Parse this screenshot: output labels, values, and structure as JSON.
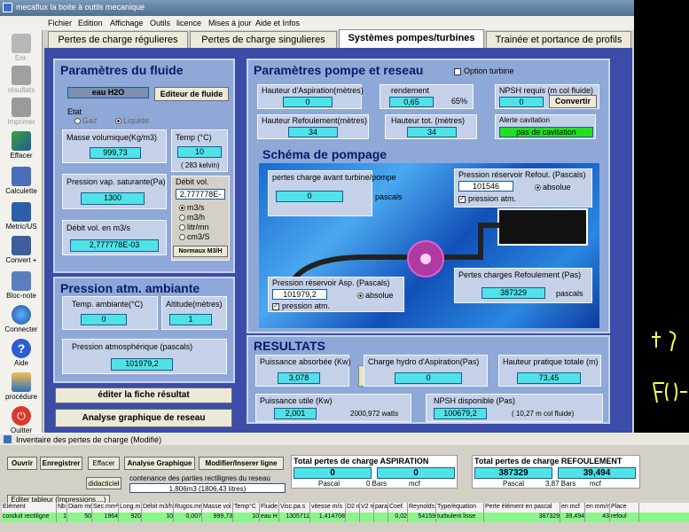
{
  "window": {
    "title": "mecaflux  la boite à outils mecanique"
  },
  "menu": [
    "Fichier",
    "Edition",
    "Affichage",
    "Outils",
    "licence",
    "Mises à jour",
    "Aide et Infos"
  ],
  "toolbar": [
    {
      "label": "Enr.",
      "icon": "save-icon",
      "enabled": false
    },
    {
      "label": "résultats",
      "icon": "results-icon",
      "enabled": false
    },
    {
      "label": "Imprimer",
      "icon": "printer-icon",
      "enabled": false
    },
    {
      "label": "Effacer",
      "icon": "eraser-icon",
      "enabled": true
    },
    {
      "label": "Calculette",
      "icon": "calculator-icon",
      "enabled": true
    },
    {
      "label": "Metric/US",
      "icon": "metric-us-icon",
      "enabled": true
    },
    {
      "label": "Convert +",
      "icon": "convert-icon",
      "enabled": true
    },
    {
      "label": "Bloc-note",
      "icon": "notepad-icon",
      "enabled": true
    },
    {
      "label": "Connecter",
      "icon": "globe-icon",
      "enabled": true
    },
    {
      "label": "Aide",
      "icon": "help-icon",
      "enabled": true
    },
    {
      "label": "procédure",
      "icon": "procedure-icon",
      "enabled": true
    },
    {
      "label": "Quitter",
      "icon": "quit-icon",
      "enabled": true
    }
  ],
  "tabs": [
    "Pertes de charge régulieres",
    "Pertes de charge singulieres",
    "Systèmes  pompes/turbines",
    "Trainée et portance de profils"
  ],
  "fluide": {
    "title": "Paramètres  du fluide",
    "fluid_name": "eau H2O",
    "editor_btn": "Editeur de fluide",
    "etat_label": "Etat",
    "gaz": "Gaz",
    "liquide": "Liquide",
    "masse_label": "Masse volumique(Kg/m3)",
    "masse_val": "999,73",
    "temp_label": "Temp (°C)",
    "temp_val": "10",
    "temp_kelvin": "( 283 kelvin)",
    "pvap_label": "Pression  vap. saturante(Pa)",
    "pvap_val": "1300",
    "debit_vol_label": "Débit vol.",
    "debit_vol_val": "2,777778E-03",
    "debit_units": [
      "m3/s",
      "m3/h",
      "litr/mn",
      "cm3/S"
    ],
    "normaux": "Normaux M3/H",
    "debit_m3s_label": "Débit vol. en m3/s",
    "debit_m3s_val": "2,777778E-03"
  },
  "atm": {
    "title": "Pression atm. ambiante",
    "temp_label": "Temp. ambiante(°C)",
    "temp_val": "0",
    "alt_label": "Altitude(mètres)",
    "alt_val": "1",
    "patm_label": "Pression atmosphérique  (pascals)",
    "patm_val": "101979,2"
  },
  "actions": {
    "fiche": "éditer la fiche résultat",
    "analyse": "Analyse graphique de reseau"
  },
  "pompe": {
    "title": "Paramètres  pompe et reseau",
    "option_turbine": "Option turbine",
    "h_asp_label": "Hauteur d'Aspiration(mètres)",
    "h_asp_val": "0",
    "rendement_label": "rendement",
    "rendement_val": "0,65",
    "rendement_pct": "65%",
    "npsh_label": "NPSH requis  (m col fluide)",
    "npsh_val": "0",
    "convertir": "Convertir",
    "h_ref_label": "Hauteur Refoulement(mètres)",
    "h_ref_val": "34",
    "h_tot_label": "Hauteur tot. (mètres)",
    "h_tot_val": "34",
    "alerte_label": "Alerte cavitation",
    "alerte_val": "pas de cavitation"
  },
  "schema": {
    "title": "Schéma de pompage",
    "pertes_avant_label": "pertes charge avant turbine/pompe",
    "pertes_avant_val": "0",
    "pascals": "pascals",
    "p_ref_label": "Pression réservoir Refoul. (Pascals)",
    "p_ref_val": "101546",
    "absolue": "absolue",
    "pression_atm": "pression atm.",
    "p_asp_label": "Pression réservoir Asp. (Pascals)",
    "p_asp_val": "101979,2",
    "pertes_ref_label": "Pertes charges Refoulement (Pas)",
    "pertes_ref_val": "387329"
  },
  "resultats": {
    "title": "RESULTATS",
    "p_abs_label": "Puissance absorbée (Kw)",
    "p_abs_val": "3,078",
    "charge_asp_label": "Charge hydro d'Aspiration(Pas)",
    "charge_asp_val": "0",
    "h_prat_label": "Hauteur pratique totale (m)",
    "h_prat_val": "73,45",
    "p_util_label": "Puissance utile (Kw)",
    "p_util_val": "2,001",
    "p_util_watts": "2000,972 watts",
    "npsh_disp_label": "NPSH disponible (Pas)",
    "npsh_disp_val": "100679,2",
    "npsh_disp_note": "( 10,27 m col fluide)"
  },
  "inventory": {
    "title": "Inventaire des pertes de charge (Modifié)",
    "buttons": [
      "Ouvrir",
      "Enregistrer",
      "Effacer",
      "Analyse Graphique",
      "Modifier/Inserer ligne"
    ],
    "didacticiel": "didacticiel",
    "contenance_label": "contenance  des parties rectilignes du  reseau",
    "contenance_val": "1,806m3 (1806,43 litres)",
    "editer": "Editer  tableur (Impressions....)",
    "asp": {
      "title": "Total pertes de charge ASPIRATION",
      "pa": "0",
      "m": "0",
      "pascal": "Pascal",
      "bars": "0 Bars",
      "mcf": "mcf"
    },
    "ref": {
      "title": "Total pertes de charge REFOULEMENT",
      "pa": "387329",
      "m": "39,494",
      "pascal": "Pascal",
      "bars": "3,87 Bars",
      "mcf": "mcf"
    },
    "columns": [
      "Elément",
      "Nb",
      "Diam mm",
      "Sec.mm²",
      "Long.m",
      "Débit m3/h",
      "Rugos.mm",
      "Masse vol",
      "Temp°C",
      "Fluide",
      "Visc.pa.s",
      "vitesse m/s",
      "D2 m",
      "V2 m",
      "para",
      "Coef.",
      "Reynolds",
      "Type/équation",
      "Perte élément en pascal",
      "en mcf",
      "en mm/m",
      "Place"
    ],
    "row": [
      "conduit rectiligne",
      "1",
      "50",
      "1964",
      "920",
      "10",
      "0,007",
      "999,73",
      "10",
      "eau H",
      "1305711",
      "1,414708",
      "",
      "",
      "",
      "0,02",
      "54159",
      "turbulent lisse",
      "387329",
      "39,494",
      "43",
      "refoul"
    ]
  }
}
